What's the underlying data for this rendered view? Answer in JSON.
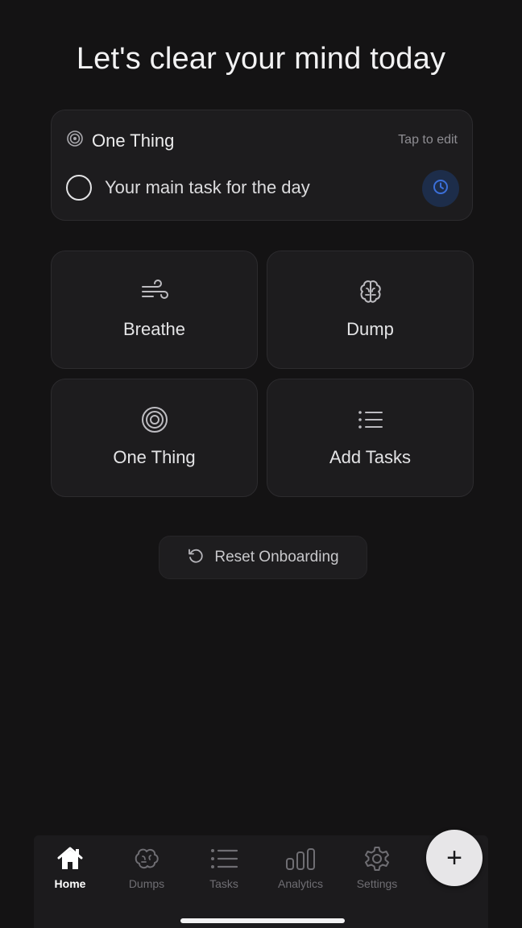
{
  "header": {
    "title": "Let's clear your mind today"
  },
  "focus_card": {
    "icon": "target-icon",
    "title": "One Thing",
    "hint": "Tap to edit",
    "task_placeholder": "Your main task for the day",
    "timer_icon": "clock-icon",
    "timer_color": "#3b6fd9"
  },
  "tiles": [
    {
      "label": "Breathe",
      "icon": "wind-icon"
    },
    {
      "label": "Dump",
      "icon": "brain-icon"
    },
    {
      "label": "One Thing",
      "icon": "target-icon"
    },
    {
      "label": "Add Tasks",
      "icon": "list-icon"
    }
  ],
  "reset": {
    "label": "Reset Onboarding",
    "icon": "rotate-ccw-icon"
  },
  "tabbar": {
    "tabs": [
      {
        "label": "Home",
        "icon": "home-icon",
        "active": true
      },
      {
        "label": "Dumps",
        "icon": "brain-icon",
        "active": false
      },
      {
        "label": "Tasks",
        "icon": "list-icon",
        "active": false
      },
      {
        "label": "Analytics",
        "icon": "bar-chart-icon",
        "active": false
      },
      {
        "label": "Settings",
        "icon": "gear-icon",
        "active": false
      }
    ]
  },
  "fab": {
    "glyph": "+",
    "icon": "plus-icon"
  }
}
